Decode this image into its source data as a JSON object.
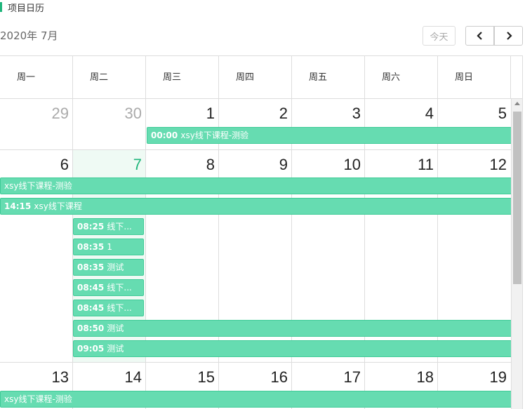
{
  "section": {
    "title": "项目日历"
  },
  "calendar": {
    "title": "2020年 7月",
    "today_label": "今天",
    "weekdays": [
      "周一",
      "周二",
      "周三",
      "周四",
      "周五",
      "周六",
      "周日"
    ],
    "weeks": [
      {
        "days": [
          "29",
          "30",
          "1",
          "2",
          "3",
          "4",
          "5"
        ]
      },
      {
        "days": [
          "6",
          "7",
          "8",
          "9",
          "10",
          "11",
          "12"
        ]
      },
      {
        "days": [
          "13",
          "14",
          "15",
          "16",
          "17",
          "18",
          "19"
        ]
      }
    ],
    "events": [
      {
        "time": "00:00",
        "title": "xsy线下课程-测验"
      },
      {
        "time": "",
        "title": "xsy线下课程-测验"
      },
      {
        "time": "14:15",
        "title": "xsy线下课程"
      },
      {
        "time": "08:25",
        "title": "线下..."
      },
      {
        "time": "08:35",
        "title": "1"
      },
      {
        "time": "08:35",
        "title": "测试"
      },
      {
        "time": "08:45",
        "title": "线下..."
      },
      {
        "time": "08:45",
        "title": "线下..."
      },
      {
        "time": "08:50",
        "title": "测试"
      },
      {
        "time": "09:05",
        "title": "测试"
      },
      {
        "time": "",
        "title": "xsy线下课程-测验"
      }
    ]
  },
  "colors": {
    "accent": "#1fb57b",
    "event_bg": "#66dcb1",
    "event_border": "#3fcb97",
    "today_bg": "#effaf4"
  }
}
